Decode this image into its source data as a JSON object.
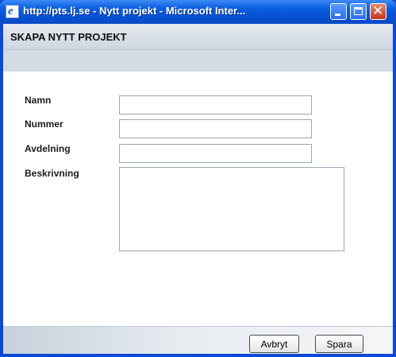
{
  "window": {
    "title": "http://pts.lj.se - Nytt projekt - Microsoft Inter...",
    "icon": "ie-icon",
    "controls": [
      "minimize-icon",
      "maximize-icon",
      "close-icon"
    ],
    "title_color": "#0A5EE0"
  },
  "header": {
    "title": "SKAPA NYTT PROJEKT"
  },
  "form": {
    "fields": [
      {
        "label": "Namn",
        "value": ""
      },
      {
        "label": "Nummer",
        "value": ""
      },
      {
        "label": "Avdelning",
        "value": ""
      },
      {
        "label": "Beskrivning",
        "value": ""
      }
    ]
  },
  "footer": {
    "cancel_label": "Avbryt",
    "save_label": "Spara"
  }
}
